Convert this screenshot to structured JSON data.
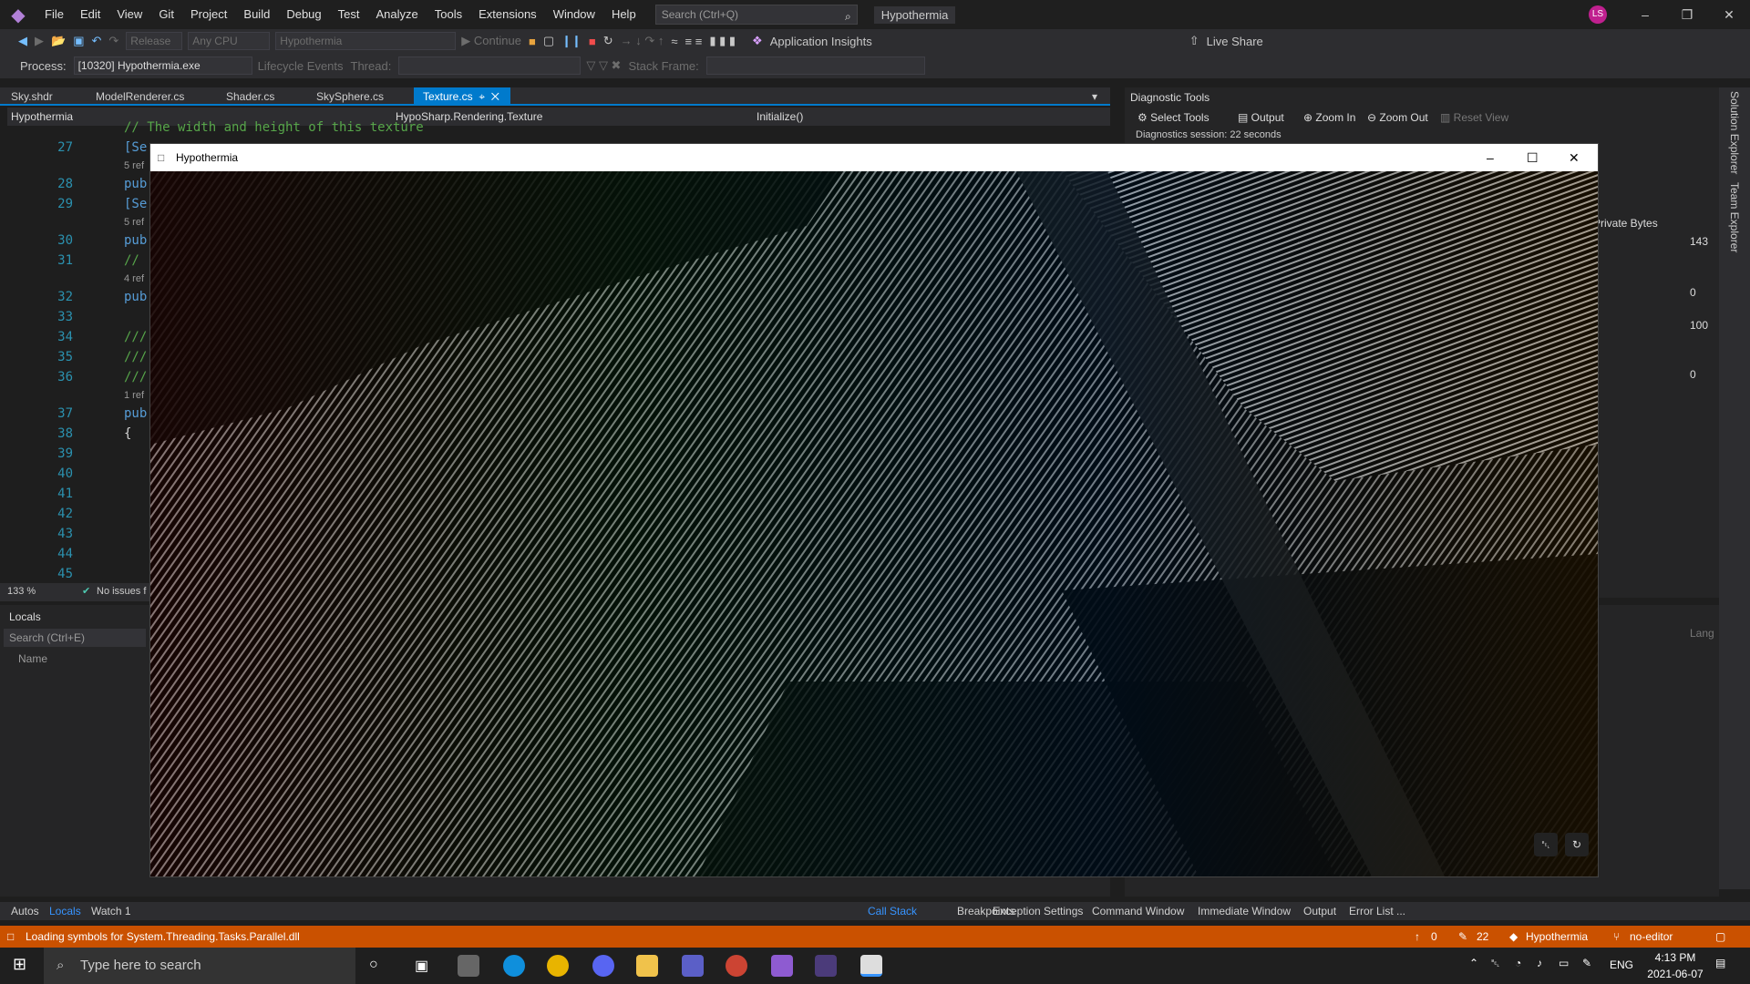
{
  "menu": [
    "File",
    "Edit",
    "View",
    "Git",
    "Project",
    "Build",
    "Debug",
    "Test",
    "Analyze",
    "Tools",
    "Extensions",
    "Window",
    "Help"
  ],
  "search": {
    "placeholder": "Search (Ctrl+Q)"
  },
  "solution_name": "Hypothermia",
  "user_initials": "LS",
  "toolbar": {
    "config": "Release",
    "platform": "Any CPU",
    "startup": "Hypothermia",
    "continue": "Continue",
    "app_insights": "Application Insights",
    "live_share": "Live Share"
  },
  "toolbar2": {
    "process_label": "Process:",
    "process_value": "[10320] Hypothermia.exe",
    "lifecycle": "Lifecycle Events",
    "thread": "Thread:",
    "stack_frame": "Stack Frame:"
  },
  "tabs": [
    "Sky.shdr",
    "ModelRenderer.cs",
    "Shader.cs",
    "SkySphere.cs",
    "Texture.cs"
  ],
  "navbar": {
    "project": "Hypothermia",
    "class": "HypoSharp.Rendering.Texture",
    "member": "Initialize()"
  },
  "editor": {
    "comment_top": "// The width and height of this texture",
    "lines": [
      "27",
      "28",
      "29",
      "30",
      "31",
      "32",
      "33",
      "34",
      "35",
      "36",
      "37",
      "38",
      "39",
      "40",
      "41",
      "42",
      "43",
      "44",
      "45"
    ],
    "snippets": {
      "l27": "[Se",
      "r1": "5 ref",
      "l28": "pub",
      "l29": "[Se",
      "r2": "5 ref",
      "l30": "pub",
      "l31": "//",
      "r3": "4 ref",
      "l32": "pub",
      "l34": "///",
      "l35": "///",
      "l36": "///",
      "r4": "1 ref",
      "l37": "pub",
      "l38": "{"
    },
    "zoom": "133 %",
    "issues": "No issues f"
  },
  "locals": {
    "title": "Locals",
    "search": "Search (Ctrl+E)",
    "col_name": "Name"
  },
  "diag": {
    "title": "Diagnostic Tools",
    "select_tools": "Select Tools",
    "output": "Output",
    "zoom_in": "Zoom In",
    "zoom_out": "Zoom Out",
    "reset_view": "Reset View",
    "session": "Diagnostics session: 22 seconds",
    "private_bytes": "Private Bytes",
    "mem_max": "143",
    "mem_min": "0",
    "cpu_max": "100",
    "cpu_min": "0",
    "lang": "Lang"
  },
  "side_rail": [
    "Solution Explorer",
    "Team Explorer"
  ],
  "bottom_left_tabs": [
    "Autos",
    "Locals",
    "Watch 1"
  ],
  "bottom_right_tabs": [
    "Call Stack",
    "Breakpoints",
    "Exception Settings",
    "Command Window",
    "Immediate Window",
    "Output",
    "Error List ..."
  ],
  "status": {
    "message": "Loading symbols for System.Threading.Tasks.Parallel.dll",
    "up": "0",
    "edits": "22",
    "repo": "Hypothermia",
    "branch": "no-editor"
  },
  "taskbar": {
    "search": "Type here to search",
    "lang": "ENG",
    "time": "4:13 PM",
    "date": "2021-06-07"
  },
  "game": {
    "title": "Hypothermia"
  },
  "colors": {
    "accent": "#007acc",
    "status": "#ca5100",
    "bg": "#1e1e1e"
  }
}
